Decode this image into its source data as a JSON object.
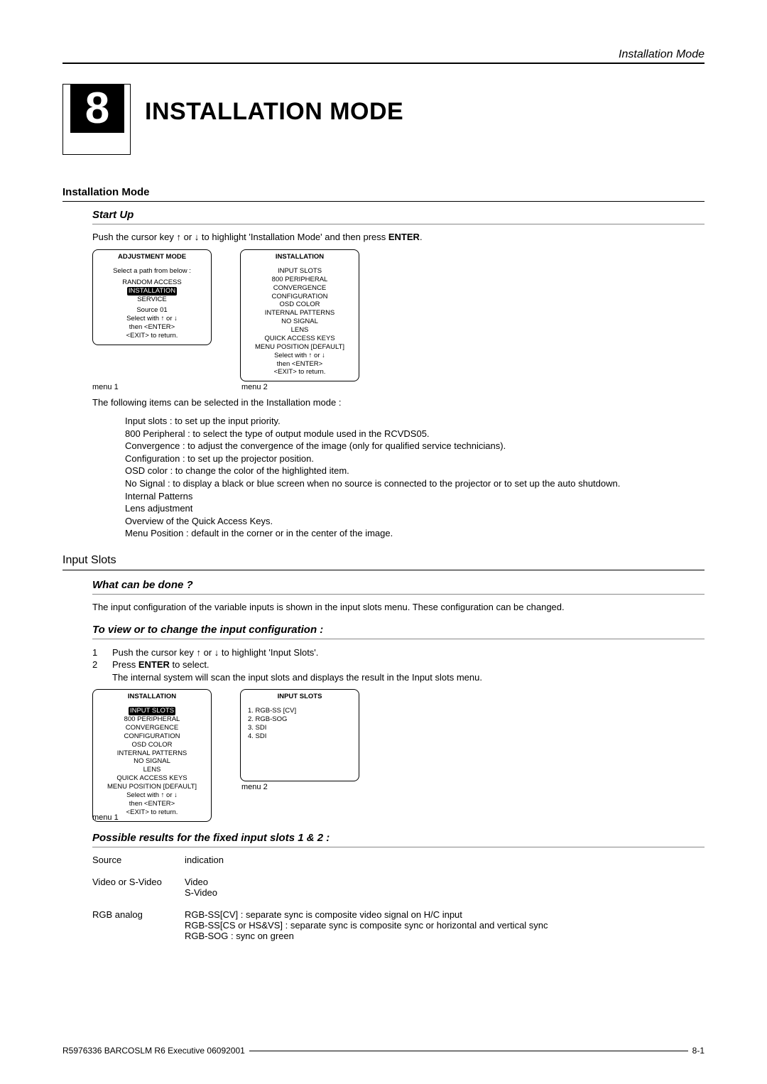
{
  "header": {
    "section": "Installation Mode"
  },
  "chapter": {
    "number": "8",
    "title": "INSTALLATION MODE"
  },
  "s1": {
    "heading": "Installation Mode",
    "sub_startup": "Start Up",
    "startup_text_a": "Push the cursor key ",
    "startup_text_b": " or ",
    "startup_text_c": " to highlight 'Installation Mode' and then press ",
    "startup_text_enter": "ENTER",
    "startup_text_d": ".",
    "following": "The following items can be selected in the Installation mode :"
  },
  "menu1": {
    "title": "ADJUSTMENT MODE",
    "line1": "Select a path from below :",
    "i1": "RANDOM ACCESS",
    "i2": "INSTALLATION",
    "i3": "SERVICE",
    "src": "Source 01",
    "sel1": "Select with ↑ or ↓",
    "sel2": "then <ENTER>",
    "sel3": "<EXIT> to return.",
    "caption": "menu 1"
  },
  "menu2": {
    "title": "INSTALLATION",
    "i1": "INPUT SLOTS",
    "i2": "800 PERIPHERAL",
    "i3": "CONVERGENCE",
    "i4": "CONFIGURATION",
    "i5": "OSD COLOR",
    "i6": "INTERNAL PATTERNS",
    "i7": "NO SIGNAL",
    "i8": "LENS",
    "i9": "QUICK ACCESS KEYS",
    "i10": "MENU POSITION [DEFAULT]",
    "sel1": "Select with ↑ or ↓",
    "sel2": "then <ENTER>",
    "sel3": "<EXIT> to return.",
    "caption": "menu 2"
  },
  "items": {
    "l1": "Input slots : to set up the input priority.",
    "l2": "800 Peripheral : to select the type of output module used in the RCVDS05.",
    "l3": "Convergence : to adjust the convergence of the image (only for qualified service technicians).",
    "l4": "Configuration : to set up the projector position.",
    "l5": "OSD color : to change the color of the highlighted item.",
    "l6": "No Signal : to display a black or blue screen when no source is connected to the projector or to set up the auto shutdown.",
    "l7": "Internal Patterns",
    "l8": "Lens adjustment",
    "l9": "Overview of the Quick Access Keys.",
    "l10": "Menu Position : default in the corner or in the center of the image."
  },
  "s2": {
    "heading": "Input Slots",
    "sub_what": "What can be done ?",
    "what_text": "The input configuration of the variable inputs is shown in the input slots menu.  These configuration can be changed.",
    "sub_view": "To view or to change the input configuration :",
    "step1a": "Push the cursor key ",
    "step1b": " or ",
    "step1c": " to highlight 'Input Slots'.",
    "step2a": "Press ",
    "step2b": "ENTER",
    "step2c": " to select.",
    "step_note": "The internal system will scan the input slots and displays the result in the Input slots menu."
  },
  "menu3": {
    "title": "INSTALLATION",
    "i1": "INPUT SLOTS",
    "i2": "800 PERIPHERAL",
    "i3": "CONVERGENCE",
    "i4": "CONFIGURATION",
    "i5": "OSD COLOR",
    "i6": "INTERNAL PATTERNS",
    "i7": "NO SIGNAL",
    "i8": "LENS",
    "i9": "QUICK ACCESS KEYS",
    "i10": "MENU POSITION [DEFAULT]",
    "sel1": "Select with ↑ or ↓",
    "sel2": "then <ENTER>",
    "sel3": "<EXIT> to return.",
    "caption": "menu 1"
  },
  "menu4": {
    "title": "INPUT SLOTS",
    "i1": "1. RGB-SS [CV]",
    "i2": "2. RGB-SOG",
    "i3": "3. SDI",
    "i4": "4. SDI",
    "caption": "menu 2"
  },
  "results": {
    "heading": "Possible results for the fixed input slots 1 & 2 :",
    "h1": "Source",
    "h2": "indication",
    "r1c1": "Video or S-Video",
    "r1c2a": "Video",
    "r1c2b": "S-Video",
    "r2c1": "RGB analog",
    "r2c2a": "RGB-SS[CV] : separate sync is composite video signal on H/C input",
    "r2c2b": "RGB-SS[CS or HS&VS] : separate sync is composite sync or horizontal and vertical sync",
    "r2c2c": "RGB-SOG : sync on green"
  },
  "footer": {
    "left": "R5976336 BARCOSLM R6 Executive 06092001",
    "right": "8-1"
  }
}
